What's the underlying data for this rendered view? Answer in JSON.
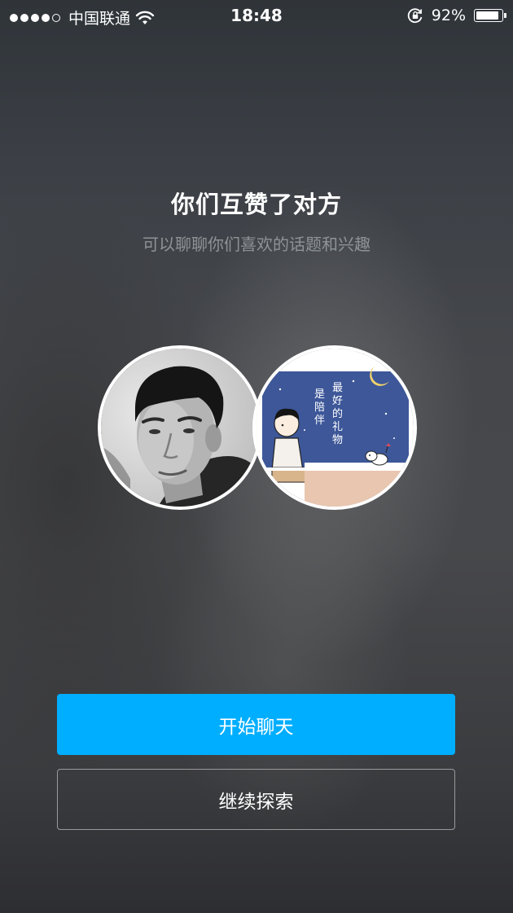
{
  "status_bar": {
    "signal_bars_filled": 4,
    "signal_bars_total": 5,
    "carrier": "中国联通",
    "time": "18:48",
    "battery_percent": "92%",
    "battery_level": 0.92,
    "icons": [
      "wifi-icon",
      "rotation-lock-icon",
      "battery-icon"
    ]
  },
  "match": {
    "title": "你们互赞了对方",
    "subtitle": "可以聊聊你们喜欢的话题和兴趣",
    "avatars": {
      "left": "user-photo",
      "right": {
        "illustration_text_left": "是陪伴",
        "illustration_text_right": "最好的礼物"
      }
    }
  },
  "actions": {
    "start_chat_label": "开始聊天",
    "continue_explore_label": "继续探索"
  },
  "colors": {
    "primary_button": "#00aeff",
    "subtitle_text": "#8f9296",
    "secondary_border": "#9a9a9c"
  }
}
